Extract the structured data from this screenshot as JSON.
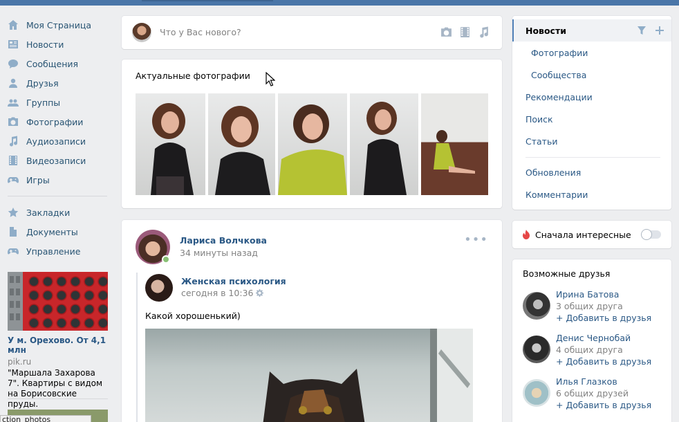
{
  "left_menu": {
    "items": [
      {
        "label": "Моя Страница",
        "icon": "home-icon"
      },
      {
        "label": "Новости",
        "icon": "news-icon"
      },
      {
        "label": "Сообщения",
        "icon": "messages-icon"
      },
      {
        "label": "Друзья",
        "icon": "user-icon"
      },
      {
        "label": "Группы",
        "icon": "groups-icon"
      },
      {
        "label": "Фотографии",
        "icon": "camera-icon"
      },
      {
        "label": "Аудиозаписи",
        "icon": "music-icon"
      },
      {
        "label": "Видеозаписи",
        "icon": "video-icon"
      },
      {
        "label": "Игры",
        "icon": "gamepad-icon"
      }
    ],
    "items2": [
      {
        "label": "Закладки",
        "icon": "star-icon"
      },
      {
        "label": "Документы",
        "icon": "document-icon"
      },
      {
        "label": "Управление",
        "icon": "gamepad-icon"
      }
    ]
  },
  "ad": {
    "title": "У м. Орехово. От 4,1 млн",
    "domain": "pik.ru",
    "text": "\"Маршала Захарова 7\". Квартиры с видом на Борисовские пруды."
  },
  "tooltip": "ction_photos",
  "post_box": {
    "placeholder": "Что у Вас нового?"
  },
  "actual_photos": {
    "title": "Актуальные фотографии"
  },
  "post": {
    "author": "Лариса Волчкова",
    "time": "34 минуты назад",
    "repost": {
      "group": "Женская психология",
      "time": "сегодня в 10:36"
    },
    "text": "Какой хорошенький)"
  },
  "right_nav": {
    "news": "Новости",
    "photos": "Фотографии",
    "communities": "Сообщества",
    "recommendations": "Рекомендации",
    "search": "Поиск",
    "articles": "Статьи",
    "updates": "Обновления",
    "comments": "Комментарии"
  },
  "interesting": {
    "label": "Сначала интересные",
    "enabled": false
  },
  "friends": {
    "title": "Возможные друзья",
    "list": [
      {
        "name": "Ирина Батова",
        "common": "3 общих друга",
        "add": "+ Добавить в друзья"
      },
      {
        "name": "Денис Чернобай",
        "common": "4 общих друга",
        "add": "+ Добавить в друзья"
      },
      {
        "name": "Илья Глазков",
        "common": "6 общих друзей",
        "add": "+ Добавить в друзья"
      }
    ]
  },
  "colors": {
    "header": "#4a76a8",
    "link": "#2a5885",
    "background": "#edeef0"
  }
}
